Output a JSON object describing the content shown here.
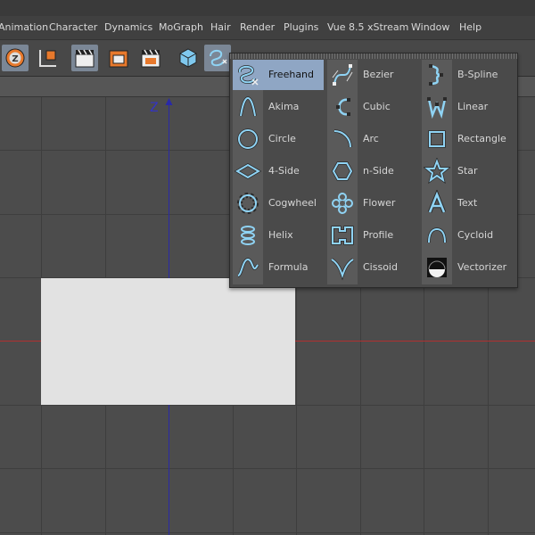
{
  "menubar": {
    "items": [
      "Animation",
      "Character",
      "Dynamics",
      "MoGraph",
      "Hair",
      "Render",
      "Plugins",
      "Vue 8.5 xStream",
      "Window",
      "Help"
    ]
  },
  "viewport": {
    "axis_label": "Z"
  },
  "spline_menu": {
    "columns": [
      [
        {
          "label": "Freehand",
          "icon": "freehand-icon",
          "selected": true
        },
        {
          "label": "Akima",
          "icon": "akima-icon"
        },
        {
          "label": "Circle",
          "icon": "circle-icon"
        },
        {
          "label": "4-Side",
          "icon": "4-side-icon"
        },
        {
          "label": "Cogwheel",
          "icon": "cogwheel-icon"
        },
        {
          "label": "Helix",
          "icon": "helix-icon"
        },
        {
          "label": "Formula",
          "icon": "formula-icon"
        }
      ],
      [
        {
          "label": "Bezier",
          "icon": "bezier-icon"
        },
        {
          "label": "Cubic",
          "icon": "cubic-icon"
        },
        {
          "label": "Arc",
          "icon": "arc-icon"
        },
        {
          "label": "n-Side",
          "icon": "n-side-icon"
        },
        {
          "label": "Flower",
          "icon": "flower-icon"
        },
        {
          "label": "Profile",
          "icon": "profile-icon"
        },
        {
          "label": "Cissoid",
          "icon": "cissoid-icon"
        }
      ],
      [
        {
          "label": "B-Spline",
          "icon": "b-spline-icon"
        },
        {
          "label": "Linear",
          "icon": "linear-icon"
        },
        {
          "label": "Rectangle",
          "icon": "rectangle-icon"
        },
        {
          "label": "Star",
          "icon": "star-icon"
        },
        {
          "label": "Text",
          "icon": "text-icon"
        },
        {
          "label": "Cycloid",
          "icon": "cycloid-icon"
        },
        {
          "label": "Vectorizer",
          "icon": "vectorizer-icon"
        }
      ]
    ]
  },
  "colors": {
    "icon_blue": "#8fd3f4",
    "selection": "#8fa6c4",
    "accent_orange": "#e8792c"
  }
}
